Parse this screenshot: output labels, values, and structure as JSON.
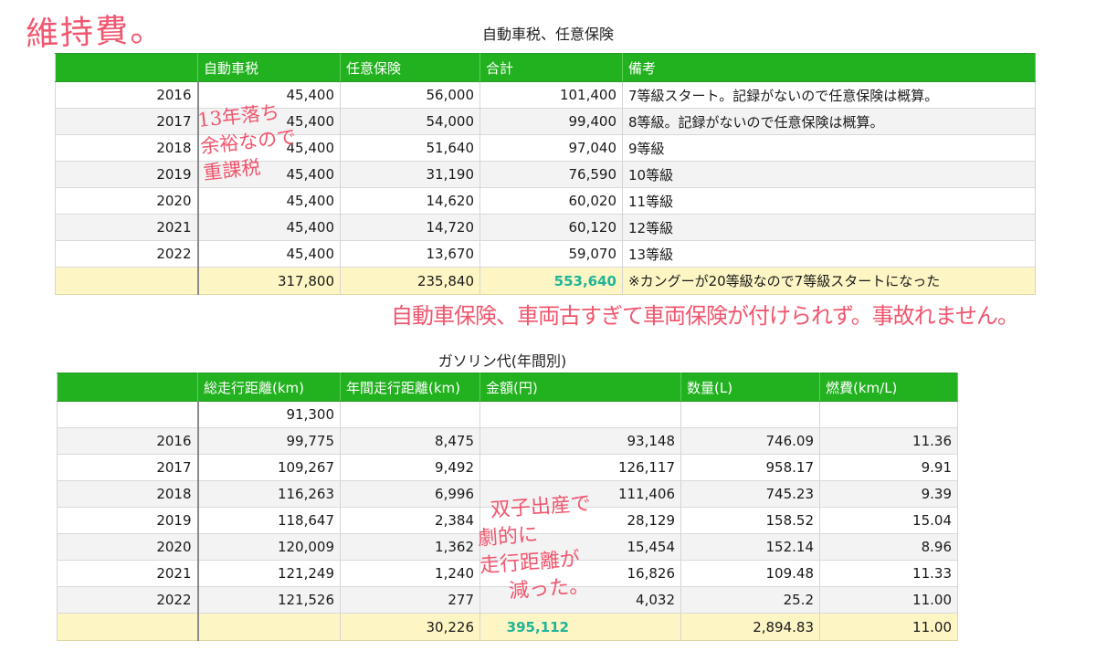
{
  "handwriting": {
    "main_title": "維持費。",
    "note_tax": [
      "13年落ち",
      "余裕なので",
      "重課税"
    ],
    "note_insurance": "自動車保険、車両古すぎて車両保険が付けられず。事故れません。",
    "note_gas": [
      "双子出産で",
      "劇的に",
      "走行距離が",
      "減った。"
    ]
  },
  "table1": {
    "title": "自動車税、任意保険",
    "headers": [
      "",
      "自動車税",
      "任意保険",
      "合計",
      "備考"
    ],
    "rows": [
      {
        "year": "2016",
        "tax": "45,400",
        "insurance": "56,000",
        "total": "101,400",
        "note": "7等級スタート。記録がないので任意保険は概算。"
      },
      {
        "year": "2017",
        "tax": "45,400",
        "insurance": "54,000",
        "total": "99,400",
        "note": "8等級。記録がないので任意保険は概算。"
      },
      {
        "year": "2018",
        "tax": "45,400",
        "insurance": "51,640",
        "total": "97,040",
        "note": "9等級"
      },
      {
        "year": "2019",
        "tax": "45,400",
        "insurance": "31,190",
        "total": "76,590",
        "note": "10等級"
      },
      {
        "year": "2020",
        "tax": "45,400",
        "insurance": "14,620",
        "total": "60,020",
        "note": "11等級"
      },
      {
        "year": "2021",
        "tax": "45,400",
        "insurance": "14,720",
        "total": "60,120",
        "note": "12等級"
      },
      {
        "year": "2022",
        "tax": "45,400",
        "insurance": "13,670",
        "total": "59,070",
        "note": "13等級"
      }
    ],
    "total": {
      "year": "",
      "tax": "317,800",
      "insurance": "235,840",
      "total": "553,640",
      "note": "※カングーが20等級なので7等級スタートになった"
    }
  },
  "table2": {
    "title": "ガソリン代(年間別)",
    "headers": [
      "",
      "総走行距離(km)",
      "年間走行距離(km)",
      "金額(円)",
      "数量(L)",
      "燃費(km/L)"
    ],
    "rows": [
      {
        "year": "",
        "odometer": "91,300",
        "annual": "",
        "cost": "",
        "liters": "",
        "mileage": ""
      },
      {
        "year": "2016",
        "odometer": "99,775",
        "annual": "8,475",
        "cost": "93,148",
        "liters": "746.09",
        "mileage": "11.36"
      },
      {
        "year": "2017",
        "odometer": "109,267",
        "annual": "9,492",
        "cost": "126,117",
        "liters": "958.17",
        "mileage": "9.91"
      },
      {
        "year": "2018",
        "odometer": "116,263",
        "annual": "6,996",
        "cost": "111,406",
        "liters": "745.23",
        "mileage": "9.39"
      },
      {
        "year": "2019",
        "odometer": "118,647",
        "annual": "2,384",
        "cost": "28,129",
        "liters": "158.52",
        "mileage": "15.04"
      },
      {
        "year": "2020",
        "odometer": "120,009",
        "annual": "1,362",
        "cost": "15,454",
        "liters": "152.14",
        "mileage": "8.96"
      },
      {
        "year": "2021",
        "odometer": "121,249",
        "annual": "1,240",
        "cost": "16,826",
        "liters": "109.48",
        "mileage": "11.33"
      },
      {
        "year": "2022",
        "odometer": "121,526",
        "annual": "277",
        "cost": "4,032",
        "liters": "25.2",
        "mileage": "11.00"
      }
    ],
    "total": {
      "year": "",
      "odometer": "",
      "annual": "30,226",
      "cost": "395,112",
      "liters": "2,894.83",
      "mileage": "11.00"
    }
  }
}
